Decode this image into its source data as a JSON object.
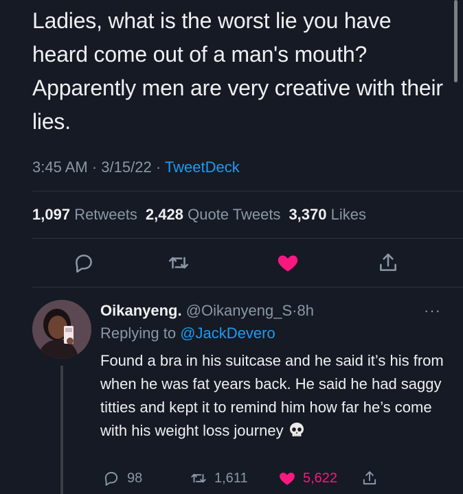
{
  "tweet": {
    "text": "Ladies, what is the worst lie you have heard come out of a man's mouth? Apparently men are very creative with their lies.",
    "time": "3:45 AM",
    "date": "3/15/22",
    "separator": "·",
    "source": "TweetDeck"
  },
  "stats": {
    "retweets_count": "1,097",
    "retweets_label": "Retweets",
    "quotes_count": "2,428",
    "quotes_label": "Quote Tweets",
    "likes_count": "3,370",
    "likes_label": "Likes"
  },
  "actions": [
    "reply-icon",
    "retweet-icon",
    "heart-icon",
    "share-icon"
  ],
  "reply": {
    "display_name": "Oikanyeng.",
    "handle": "@Oikanyeng_S",
    "separator": "·",
    "age": "8h",
    "more": "···",
    "replying_prefix": "Replying to",
    "replying_to": "@JackDevero",
    "text": "Found a bra in his suitcase and he said it’s his from when he was fat years back. He said he had saggy titties and kept it to remind him how far he’s come with his weight loss journey",
    "emoji": "skull",
    "reply_count": "98",
    "retweet_count": "1,611",
    "like_count": "5,622"
  },
  "colors": {
    "background": "#151a24",
    "text": "#eef0f2",
    "muted": "#8b98a5",
    "accent": "#1d9bf0",
    "like": "#f91880"
  }
}
